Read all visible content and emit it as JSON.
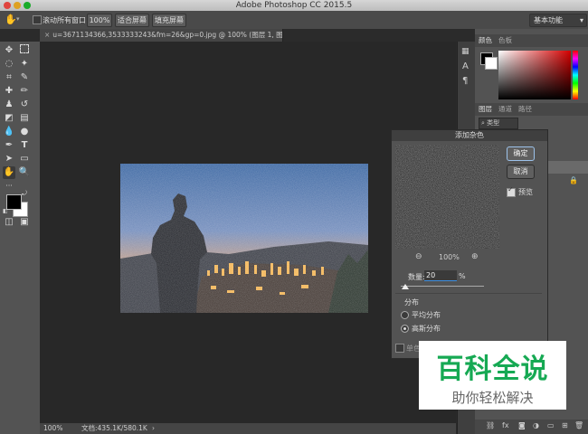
{
  "window": {
    "title": "Adobe Photoshop CC 2015.5"
  },
  "options_bar": {
    "scroll_all_windows": "滚动所有窗口",
    "zoom_100": "100%",
    "fit_screen": "适合屏幕",
    "fill_screen": "填充屏幕",
    "workspace": "基本功能"
  },
  "document": {
    "tab_title": "u=3671134366,3533333243&fm=26&gp=0.jpg @ 100% (图层 1, 图层蒙版/8) *",
    "zoom": "100%",
    "doc_size": "文档:435.1K/580.1K"
  },
  "right_panel": {
    "tab_color": "颜色",
    "tab_swatches": "色板",
    "tab_layers": "图层",
    "tab_channels": "通道",
    "tab_paths": "路径",
    "kind_filter": "类型"
  },
  "dialog": {
    "title": "添加杂色",
    "ok": "确定",
    "cancel": "取消",
    "preview": "预览",
    "zoom_pct": "100%",
    "amount_label": "数量:",
    "amount_value": "20",
    "amount_unit": "%",
    "amount_fraction": 0.05,
    "distribution_label": "分布",
    "uniform": "平均分布",
    "gaussian": "高斯分布",
    "monochrome": "单色"
  },
  "watermark": {
    "title": "百科全说",
    "subtitle": "助你轻松解决"
  },
  "colors": {
    "accent_blue": "#3d8ee0",
    "watermark_green": "#16a953"
  }
}
